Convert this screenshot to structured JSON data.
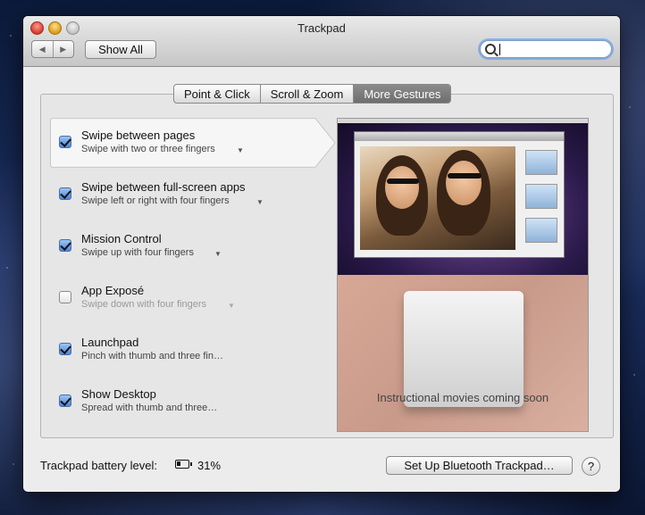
{
  "window": {
    "title": "Trackpad"
  },
  "toolbar": {
    "back_icon": "back-arrow-icon",
    "forward_icon": "forward-arrow-icon",
    "show_all_label": "Show All",
    "search_value": "",
    "search_icon": "magnifier-icon"
  },
  "tabs": [
    {
      "label": "Point & Click",
      "active": false
    },
    {
      "label": "Scroll & Zoom",
      "active": false
    },
    {
      "label": "More Gestures",
      "active": true
    }
  ],
  "gestures": [
    {
      "title": "Swipe between pages",
      "subtitle": "Swipe with two or three fingers",
      "checked": true,
      "has_menu": true,
      "selected": true
    },
    {
      "title": "Swipe between full-screen apps",
      "subtitle": "Swipe left or right with four fingers",
      "checked": true,
      "has_menu": true,
      "selected": false
    },
    {
      "title": "Mission Control",
      "subtitle": "Swipe up with four fingers",
      "checked": true,
      "has_menu": true,
      "selected": false
    },
    {
      "title": "App Exposé",
      "subtitle": "Swipe down with four fingers",
      "checked": false,
      "has_menu": true,
      "selected": false
    },
    {
      "title": "Launchpad",
      "subtitle": "Pinch with thumb and three fin…",
      "checked": true,
      "has_menu": false,
      "selected": false
    },
    {
      "title": "Show Desktop",
      "subtitle": "Spread with thumb and three…",
      "checked": true,
      "has_menu": false,
      "selected": false
    }
  ],
  "preview": {
    "message": "Instructional movies coming soon"
  },
  "footer": {
    "battery_label": "Trackpad battery level:",
    "battery_value": "31%",
    "battery_level": 0.31,
    "setup_label": "Set Up Bluetooth Trackpad…",
    "help_label": "?"
  }
}
